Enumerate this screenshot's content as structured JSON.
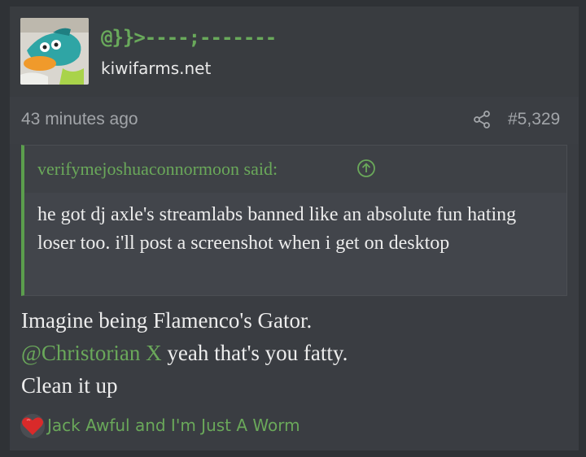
{
  "post": {
    "username": "@}}>----;-------",
    "site": "kiwifarms.net",
    "timestamp": "43 minutes ago",
    "post_number": "#5,329",
    "avatar_icon": "platypus-avatar-icon",
    "share_icon": "share-icon"
  },
  "quote": {
    "author_said": "verifymejoshuaconnormoon said:",
    "up_icon": "arrow-up-circle-icon",
    "text": "he got dj axle's streamlabs banned like an absolute fun hating loser too. i'll post a screenshot when i get on desktop"
  },
  "message": {
    "line1": "Imagine being Flamenco's Gator.",
    "mention": "@Christorian X",
    "line2_rest": " yeah that's you fatty.",
    "line3": "Clean it up"
  },
  "reactions": {
    "icon": "heart-icon",
    "text": "Jack Awful and I'm Just A Worm"
  },
  "colors": {
    "accent_green": "#6aa85a",
    "background": "#2f3236",
    "card": "#3a3d42"
  }
}
